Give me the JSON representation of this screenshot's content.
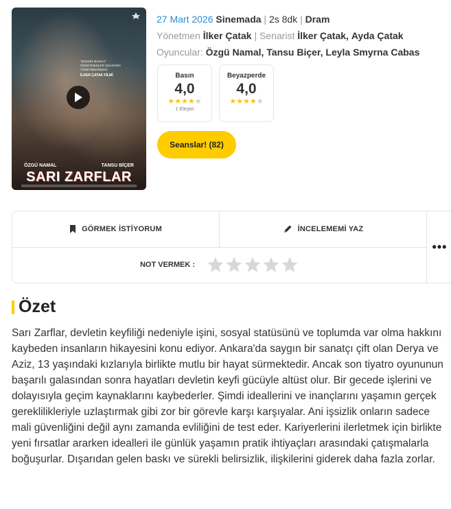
{
  "poster": {
    "title": "SARI ZARFLAR",
    "cast_left": "ÖZGÜ NAMAL",
    "cast_right": "TANSU BİÇER",
    "logo_text": "74. Uluslararası Berlin Film Festivali Berlinale Yarışma",
    "tagline": "\"BOZKIR MASALI\" ÖĞRETMENLER ODASI'NIN YÖNETMENİNDEN",
    "director_line": "İLKER ÇATAK FİLMİ",
    "play_icon": "play-icon"
  },
  "meta": {
    "date": "27 Mart 2026",
    "status": "Sinemada",
    "duration": "2s 8dk",
    "genre": "Dram",
    "sep": "|",
    "director_label": "Yönetmen",
    "director": "İlker Çatak",
    "writer_label": "Senarist",
    "writers": [
      "İlker Çatak",
      "Ayda Çatak"
    ],
    "cast_label": "Oyuncular:",
    "cast": [
      "Özgü Namal",
      "Tansu Biçer",
      "Leyla Smyrna Cabas"
    ]
  },
  "scores": {
    "press": {
      "label": "Basın",
      "value": "4,0",
      "stars": 4,
      "count": "1 Eleştiri"
    },
    "audience": {
      "label": "Beyazperde",
      "value": "4,0",
      "stars": 4
    }
  },
  "showtimes_button": "Seanslar! (82)",
  "actions": {
    "watchlist": "GÖRMEK İSTİYORUM",
    "review": "İNCELEMEMİ YAZ",
    "rate_label": "NOT VERMEK :",
    "more": "•••"
  },
  "summary": {
    "title": "Özet",
    "text": "Sarı Zarflar, devletin keyfiliği nedeniyle işini, sosyal statüsünü ve toplumda var olma hakkını kaybeden insanların hikayesini konu ediyor. Ankara'da saygın bir sanatçı çift olan Derya ve Aziz, 13 yaşındaki kızlarıyla birlikte mutlu bir hayat sürmektedir. Ancak son tiyatro oyununun başarılı galasından sonra hayatları devletin keyfi gücüyle altüst olur. Bir gecede işlerini ve dolayısıyla geçim kaynaklarını kaybederler. Şimdi ideallerini ve inançlarını yaşamın gerçek gereklilikleriyle uzlaştırmak gibi zor bir görevle karşı karşıyalar. Ani işsizlik onların sadece mali güvenliğini değil aynı zamanda evliliğini de test eder. Kariyerlerini ilerletmek için birlikte yeni fırsatlar ararken idealleri ile günlük yaşamın pratik ihtiyaçları arasındaki çatışmalarla boğuşurlar. Dışarıdan gelen baskı ve sürekli belirsizlik, ilişkilerini giderek daha fazla zorlar."
  },
  "colors": {
    "accent": "#ffcc00",
    "link": "#2d8bd3",
    "star_on": "#f5c518",
    "star_off": "#cfcfcf"
  }
}
